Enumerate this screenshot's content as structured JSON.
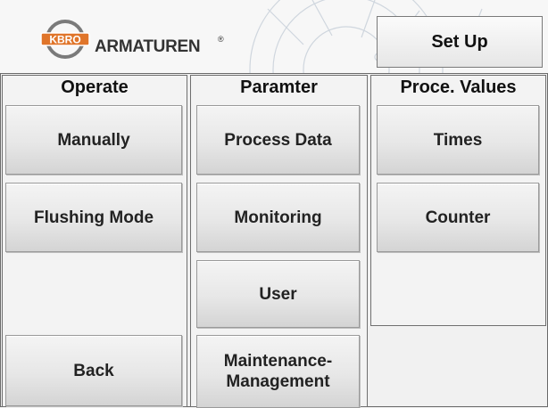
{
  "header": {
    "logo_badge": "KBRO",
    "logo_text": "ARMATUREN",
    "logo_reg": "®",
    "setup_label": "Set Up"
  },
  "columns": {
    "operate": {
      "title": "Operate",
      "buttons": [
        "Manually",
        "Flushing Mode"
      ],
      "back_label": "Back"
    },
    "parameter": {
      "title": "Paramter",
      "buttons": [
        "Process Data",
        "Monitoring",
        "User",
        "Maintenance-\nManagement"
      ]
    },
    "process_values": {
      "title": "Proce. Values",
      "buttons": [
        "Times",
        "Counter"
      ]
    }
  },
  "colors": {
    "logo_badge": "#e0752a",
    "logo_ring": "#777777",
    "button_top": "#f4f4f4",
    "button_bottom": "#d4d4d4",
    "border": "#6f6f6f"
  },
  "icons": {
    "logo": "kbro-logo-icon",
    "watermark": "gear-watermark-icon"
  }
}
